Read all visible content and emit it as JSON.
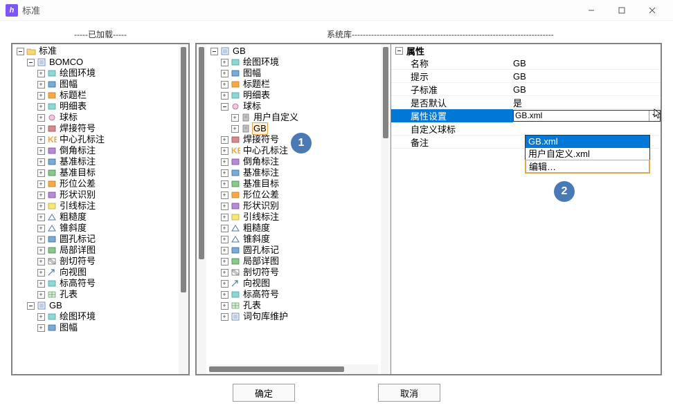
{
  "window": {
    "title": "标准",
    "app_icon_letter": "h"
  },
  "headers": {
    "loaded": "-----已加载-----",
    "library": "系统库-------------------------------------------------------------------------"
  },
  "tree_loaded": {
    "root": "标准",
    "bomco": "BOMCO",
    "items": [
      "绘图环境",
      "图幅",
      "标题栏",
      "明细表",
      "球标",
      "焊接符号",
      "中心孔标注",
      "倒角标注",
      "基准标注",
      "基准目标",
      "形位公差",
      "形状识别",
      "引线标注",
      "粗糙度",
      "锥斜度",
      "圆孔标记",
      "局部详图",
      "剖切符号",
      "向视图",
      "标高符号",
      "孔表"
    ],
    "gb": "GB",
    "gb_items": [
      "绘图环境",
      "图幅"
    ]
  },
  "tree_lib": {
    "root": "GB",
    "huitu": "绘图环境",
    "tufu": "图幅",
    "biaotilan": "标题栏",
    "mingxibiao": "明细表",
    "qiubiao": "球标",
    "qiubiao_children": {
      "yonghuzidingyi": "用户自定义",
      "gb": "GB"
    },
    "items_after": [
      "焊接符号",
      "中心孔标注",
      "倒角标注",
      "基准标注",
      "基准目标",
      "形位公差",
      "形状识别",
      "引线标注",
      "粗糙度",
      "锥斜度",
      "圆孔标记",
      "局部详图",
      "剖切符号",
      "向视图",
      "标高符号",
      "孔表",
      "词句库维护"
    ]
  },
  "properties": {
    "header": "属性",
    "rows": {
      "name": {
        "label": "名称",
        "value": "GB"
      },
      "tip": {
        "label": "提示",
        "value": "GB"
      },
      "substd": {
        "label": "子标准",
        "value": "GB"
      },
      "isdefault": {
        "label": "是否默认",
        "value": "是"
      },
      "propset": {
        "label": "属性设置",
        "value": "GB.xml"
      },
      "customball": {
        "label": "自定义球标",
        "value": ""
      },
      "remark": {
        "label": "备注",
        "value": ""
      }
    },
    "dropdown": {
      "opt1": "GB.xml",
      "opt2": "用户自定义.xml",
      "edit": "编辑…"
    }
  },
  "buttons": {
    "ok": "确定",
    "cancel": "取消"
  },
  "callouts": {
    "one": "1",
    "two": "2"
  }
}
